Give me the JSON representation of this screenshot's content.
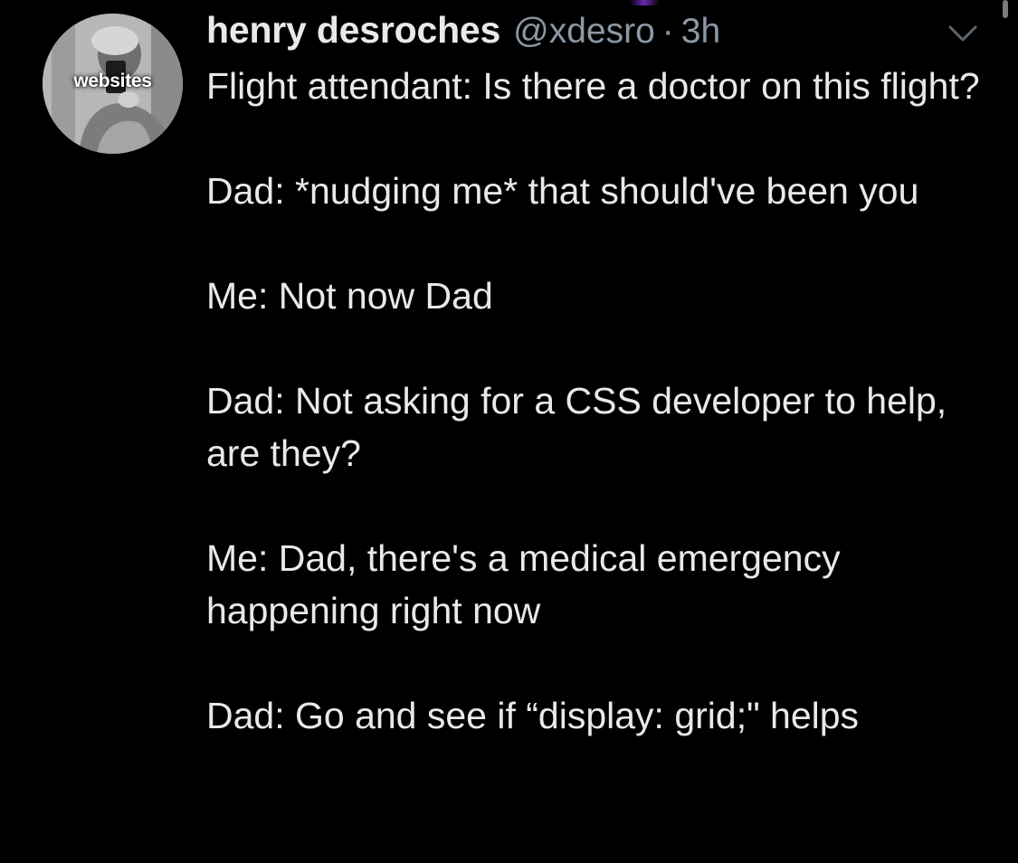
{
  "tweet": {
    "avatar_text": "websites",
    "display_name": "henry desroches",
    "handle": "@xdesro",
    "separator": "·",
    "time": "3h",
    "paragraphs": [
      "Flight attendant: Is there a doctor on this flight?",
      "Dad: *nudging me* that should've been you",
      "Me: Not now Dad",
      "Dad: Not asking for a CSS developer to help, are they?",
      "Me: Dad, there's a medical emergency happening right now",
      "Dad: Go and see if “display: grid;\" helps"
    ]
  },
  "icons": {
    "more": "chevron-down-icon"
  },
  "colors": {
    "background": "#000000",
    "text": "#e7e9ea",
    "secondary_text": "#8b98a5"
  }
}
